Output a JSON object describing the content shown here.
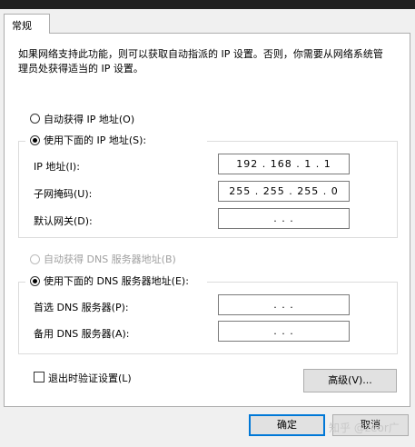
{
  "tab": {
    "label": "常规"
  },
  "description": "如果网络支持此功能，则可以获取自动指派的 IP 设置。否则，你需要从网络系统管理员处获得适当的 IP 设置。",
  "ip": {
    "auto_label": "自动获得 IP 地址(O)",
    "manual_label": "使用下面的 IP 地址(S):",
    "address_label": "IP 地址(I):",
    "address_value": "192 . 168 .  1  .  1",
    "subnet_label": "子网掩码(U):",
    "subnet_value": "255 . 255 . 255 .  0",
    "gateway_label": "默认网关(D):",
    "gateway_value": " .    .    . "
  },
  "dns": {
    "auto_label": "自动获得 DNS 服务器地址(B)",
    "manual_label": "使用下面的 DNS 服务器地址(E):",
    "preferred_label": "首选 DNS 服务器(P):",
    "preferred_value": " .    .    . ",
    "alternate_label": "备用 DNS 服务器(A):",
    "alternate_value": " .    .    . "
  },
  "validate_label": "退出时验证设置(L)",
  "advanced_label": "高级(V)...",
  "ok_label": "确定",
  "cancel_label": "取消",
  "watermark": "知乎 @zeor广"
}
